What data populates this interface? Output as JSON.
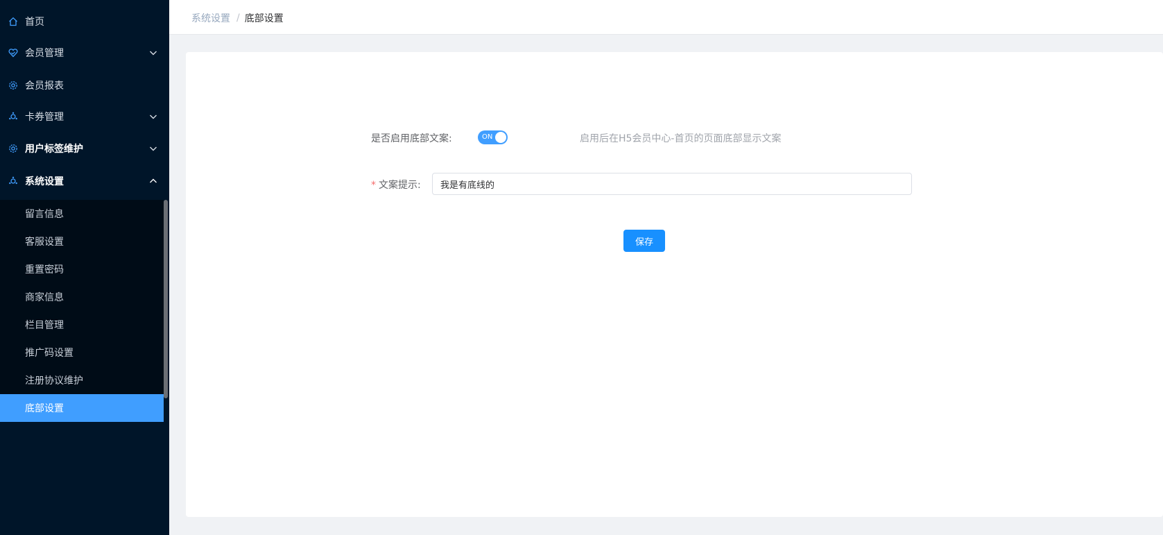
{
  "sidebar": {
    "menu": [
      {
        "label": "首页",
        "icon": "home-icon",
        "expandable": false
      },
      {
        "label": "会员管理",
        "icon": "heart-shield-icon",
        "expandable": true,
        "expanded": false
      },
      {
        "label": "会员报表",
        "icon": "gear-icon",
        "expandable": false
      },
      {
        "label": "卡券管理",
        "icon": "cog-network-icon",
        "expandable": true,
        "expanded": false
      },
      {
        "label": "用户标签维护",
        "icon": "gear-icon",
        "expandable": true,
        "expanded": false
      },
      {
        "label": "系统设置",
        "icon": "cog-network-icon",
        "expandable": true,
        "expanded": true
      }
    ],
    "submenu": [
      {
        "label": "留言信息"
      },
      {
        "label": "客服设置"
      },
      {
        "label": "重置密码"
      },
      {
        "label": "商家信息"
      },
      {
        "label": "栏目管理"
      },
      {
        "label": "推广码设置"
      },
      {
        "label": "注册协议维护"
      },
      {
        "label": "底部设置",
        "active": true
      }
    ]
  },
  "breadcrumb": {
    "parent": "系统设置",
    "separator": "/",
    "current": "底部设置"
  },
  "form": {
    "enable_label": "是否启用底部文案:",
    "switch_text": "ON",
    "switch_on": true,
    "hint": "启用后在H5会员中心-首页的页面底部显示文案",
    "required_mark": "*",
    "text_label": "文案提示:",
    "text_value": "我是有底线的",
    "save_label": "保存"
  },
  "colors": {
    "sidebar_bg": "#001529",
    "submenu_bg": "#000c17",
    "active": "#409eff",
    "primary_button": "#1890ff"
  }
}
